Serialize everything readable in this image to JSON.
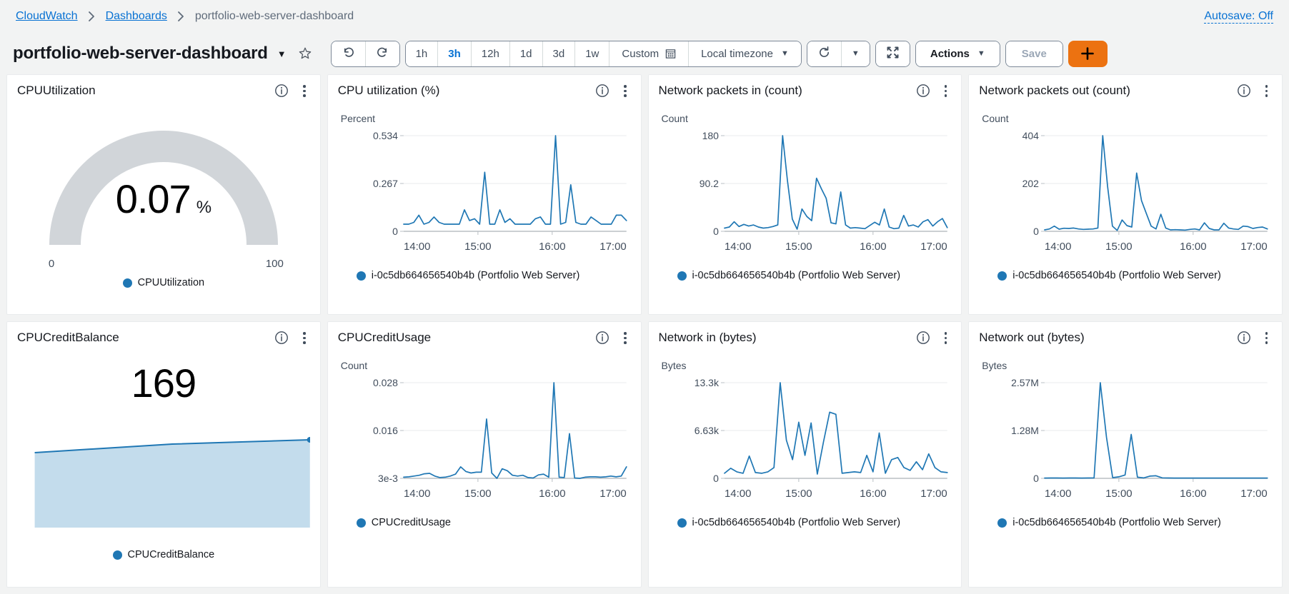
{
  "breadcrumb": {
    "items": [
      {
        "label": "CloudWatch",
        "link": true
      },
      {
        "label": "Dashboards",
        "link": true
      },
      {
        "label": "portfolio-web-server-dashboard",
        "link": false
      }
    ],
    "autosave": "Autosave: Off"
  },
  "header": {
    "title": "portfolio-web-server-dashboard",
    "title_caret": "▼",
    "star_icon": "star-outline-icon"
  },
  "toolbar": {
    "undo_icon": "undo-icon",
    "redo_icon": "redo-icon",
    "ranges": [
      "1h",
      "3h",
      "12h",
      "1d",
      "3d",
      "1w"
    ],
    "active_range": "3h",
    "custom_label": "Custom",
    "calendar_icon": "calendar-icon",
    "timezone_label": "Local timezone",
    "refresh_icon": "refresh-icon",
    "refresh_caret": "▼",
    "fullscreen_icon": "expand-icon",
    "actions_label": "Actions",
    "actions_caret": "▼",
    "save_label": "Save",
    "add_label": "+"
  },
  "widget_icons": {
    "info": "info-circle-icon",
    "menu": "more-vertical-icon"
  },
  "series_legend": "i-0c5db664656540b4b (Portfolio Web Server)",
  "chart_data": [
    {
      "id": "cpu-utilization-gauge",
      "type": "gauge",
      "title": "CPUUtilization",
      "value": "0.07",
      "unit": "%",
      "min": "0",
      "max": "100",
      "min_value": 0,
      "max_value": 100,
      "numeric_value": 0.07,
      "legend": "CPUUtilization",
      "color": "#1f77b4",
      "track_color": "#d1d5d9"
    },
    {
      "id": "cpu-utilization-line",
      "type": "line",
      "title": "CPU utilization (%)",
      "ylabel": "Percent",
      "yticks": [
        "0",
        "0.267",
        "0.534"
      ],
      "ylim": [
        0,
        0.534
      ],
      "xticks": [
        "14:00",
        "15:00",
        "16:00",
        "17:00"
      ],
      "xlabel": "",
      "grid": true,
      "legend_position": "bottom-left",
      "series": [
        {
          "name": "i-0c5db664656540b4b (Portfolio Web Server)",
          "color": "#1f77b4",
          "values": [
            0.04,
            0.04,
            0.05,
            0.09,
            0.04,
            0.05,
            0.08,
            0.05,
            0.04,
            0.04,
            0.04,
            0.04,
            0.12,
            0.06,
            0.07,
            0.04,
            0.33,
            0.04,
            0.04,
            0.12,
            0.05,
            0.07,
            0.04,
            0.04,
            0.04,
            0.04,
            0.07,
            0.08,
            0.04,
            0.04,
            0.534,
            0.04,
            0.05,
            0.26,
            0.05,
            0.04,
            0.04,
            0.08,
            0.06,
            0.04,
            0.04,
            0.04,
            0.09,
            0.09,
            0.06
          ]
        }
      ]
    },
    {
      "id": "network-packets-in",
      "type": "line",
      "title": "Network packets in (count)",
      "ylabel": "Count",
      "yticks": [
        "0",
        "90.2",
        "180"
      ],
      "ylim": [
        0,
        180
      ],
      "xticks": [
        "14:00",
        "15:00",
        "16:00",
        "17:00"
      ],
      "xlabel": "",
      "grid": true,
      "legend_position": "bottom-left",
      "series": [
        {
          "name": "i-0c5db664656540b4b (Portfolio Web Server)",
          "color": "#1f77b4",
          "values": [
            6,
            8,
            18,
            9,
            13,
            10,
            12,
            8,
            6,
            7,
            9,
            12,
            180,
            95,
            23,
            4,
            42,
            28,
            20,
            100,
            80,
            62,
            16,
            14,
            74,
            12,
            6,
            7,
            6,
            5,
            11,
            17,
            12,
            42,
            8,
            5,
            6,
            30,
            10,
            12,
            8,
            18,
            22,
            10,
            18,
            24,
            7
          ]
        }
      ]
    },
    {
      "id": "network-packets-out",
      "type": "line",
      "title": "Network packets out (count)",
      "ylabel": "Count",
      "yticks": [
        "0",
        "202",
        "404"
      ],
      "ylim": [
        0,
        404
      ],
      "xticks": [
        "14:00",
        "15:00",
        "16:00",
        "17:00"
      ],
      "xlabel": "",
      "grid": true,
      "legend_position": "bottom-left",
      "series": [
        {
          "name": "i-0c5db664656540b4b (Portfolio Web Server)",
          "color": "#1f77b4",
          "values": [
            6,
            10,
            22,
            9,
            13,
            12,
            14,
            10,
            8,
            9,
            10,
            14,
            404,
            190,
            22,
            4,
            48,
            24,
            18,
            246,
            130,
            76,
            22,
            10,
            72,
            14,
            6,
            7,
            6,
            5,
            8,
            10,
            6,
            36,
            12,
            6,
            6,
            34,
            14,
            10,
            8,
            22,
            20,
            12,
            16,
            18,
            10
          ]
        }
      ]
    },
    {
      "id": "cpu-credit-balance",
      "type": "single-value",
      "title": "CPUCreditBalance",
      "value": "169",
      "legend": "CPUCreditBalance",
      "color": "#1f77b4",
      "fill_color": "#c3dcec",
      "spark_values": [
        163,
        165,
        167,
        168,
        169
      ],
      "end_marker": true
    },
    {
      "id": "cpu-credit-usage",
      "type": "line",
      "title": "CPUCreditUsage",
      "ylabel": "Count",
      "yticks": [
        "3e-3",
        "0.016",
        "0.028"
      ],
      "ylim": [
        0.003,
        0.028
      ],
      "xticks": [
        "14:00",
        "15:00",
        "16:00",
        "17:00"
      ],
      "xlabel": "",
      "grid": true,
      "legend_position": "bottom-left",
      "legend": "CPUCreditUsage",
      "series": [
        {
          "name": "CPUCreditUsage",
          "color": "#1f77b4",
          "values": [
            0.0033,
            0.0034,
            0.0036,
            0.0038,
            0.0042,
            0.0043,
            0.0036,
            0.0032,
            0.0033,
            0.0036,
            0.0041,
            0.006,
            0.0048,
            0.0044,
            0.0046,
            0.0046,
            0.0185,
            0.0044,
            0.003,
            0.0055,
            0.005,
            0.0038,
            0.0036,
            0.0038,
            0.0032,
            0.0031,
            0.0039,
            0.0041,
            0.0033,
            0.028,
            0.0033,
            0.0032,
            0.0147,
            0.0031,
            0.003,
            0.0033,
            0.0034,
            0.0034,
            0.0033,
            0.0034,
            0.0036,
            0.0034,
            0.0036,
            0.006
          ]
        }
      ]
    },
    {
      "id": "network-in-bytes",
      "type": "line",
      "title": "Network in (bytes)",
      "ylabel": "Bytes",
      "yticks": [
        "0",
        "6.63k",
        "13.3k"
      ],
      "ylim": [
        0,
        13300
      ],
      "xticks": [
        "14:00",
        "15:00",
        "16:00",
        "17:00"
      ],
      "xlabel": "",
      "grid": true,
      "legend_position": "bottom-left",
      "series": [
        {
          "name": "i-0c5db664656540b4b (Portfolio Web Server)",
          "color": "#1f77b4",
          "values": [
            700,
            1400,
            900,
            700,
            3100,
            800,
            700,
            900,
            1500,
            13300,
            5300,
            2600,
            7800,
            3200,
            7700,
            600,
            5100,
            9200,
            8900,
            700,
            800,
            900,
            800,
            3200,
            900,
            6300,
            700,
            2600,
            2900,
            1500,
            1100,
            2300,
            1200,
            3400,
            1500,
            900,
            800
          ]
        }
      ]
    },
    {
      "id": "network-out-bytes",
      "type": "line",
      "title": "Network out (bytes)",
      "ylabel": "Bytes",
      "yticks": [
        "0",
        "1.28M",
        "2.57M"
      ],
      "ylim": [
        0,
        2570000
      ],
      "xticks": [
        "14:00",
        "15:00",
        "16:00",
        "17:00"
      ],
      "xlabel": "",
      "grid": true,
      "legend_position": "bottom-left",
      "series": [
        {
          "name": "i-0c5db664656540b4b (Portfolio Web Server)",
          "color": "#1f77b4",
          "values": [
            8000,
            9000,
            9000,
            8000,
            9000,
            9000,
            8000,
            9000,
            12000,
            2570000,
            1100000,
            20000,
            40000,
            90000,
            1180000,
            30000,
            12000,
            60000,
            70000,
            14000,
            9000,
            8000,
            8000,
            8000,
            8000,
            8000,
            8000,
            8000,
            8000,
            8000,
            8000,
            8000,
            8000,
            8000,
            8000,
            8000,
            8000
          ]
        }
      ]
    }
  ]
}
